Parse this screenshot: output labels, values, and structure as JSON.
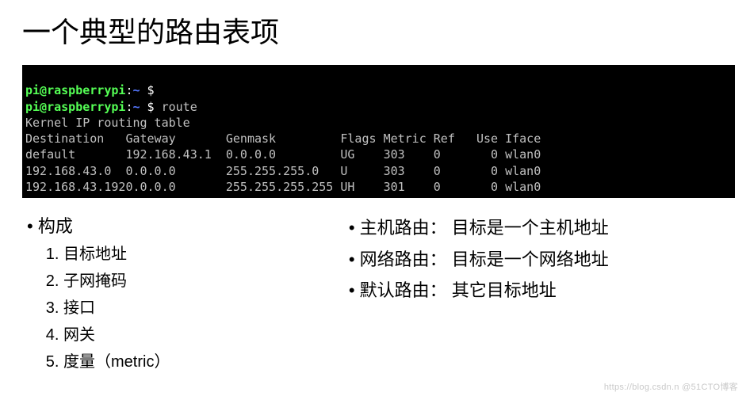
{
  "title": "一个典型的路由表项",
  "terminal": {
    "prompt_user": "pi@raspberrypi",
    "prompt_sep": ":",
    "prompt_path": "~ ",
    "prompt_dollar": "$",
    "cmd": " route",
    "header_line": "Kernel IP routing table",
    "cols": {
      "dest": "Destination   ",
      "gw": "Gateway       ",
      "mask": "Genmask         ",
      "flags": "Flags ",
      "metric": "Metric ",
      "ref": "Ref   ",
      "use": "Use ",
      "iface": "Iface"
    },
    "rows": [
      {
        "dest": "default       ",
        "gw": "192.168.43.1  ",
        "mask": "0.0.0.0         ",
        "flags": "UG    ",
        "metric": "303    ",
        "ref": "0     ",
        "use": "  0 ",
        "iface": "wlan0"
      },
      {
        "dest": "192.168.43.0  ",
        "gw": "0.0.0.0       ",
        "mask": "255.255.255.0   ",
        "flags": "U     ",
        "metric": "303    ",
        "ref": "0     ",
        "use": "  0 ",
        "iface": "wlan0"
      },
      {
        "dest": "192.168.43.192",
        "gw": "0.0.0.0       ",
        "mask": "255.255.255.255 ",
        "flags": "UH    ",
        "metric": "301    ",
        "ref": "0     ",
        "use": "  0 ",
        "iface": "wlan0"
      }
    ]
  },
  "left": {
    "header": "• 构成",
    "items": [
      "目标地址",
      "子网掩码",
      "接口",
      "网关",
      "度量（metric）"
    ]
  },
  "right": {
    "items": [
      "• 主机路由： 目标是一个主机地址",
      "• 网络路由： 目标是一个网络地址",
      "• 默认路由： 其它目标地址"
    ]
  },
  "watermark": "https://blog.csdn.n @51CTO博客"
}
